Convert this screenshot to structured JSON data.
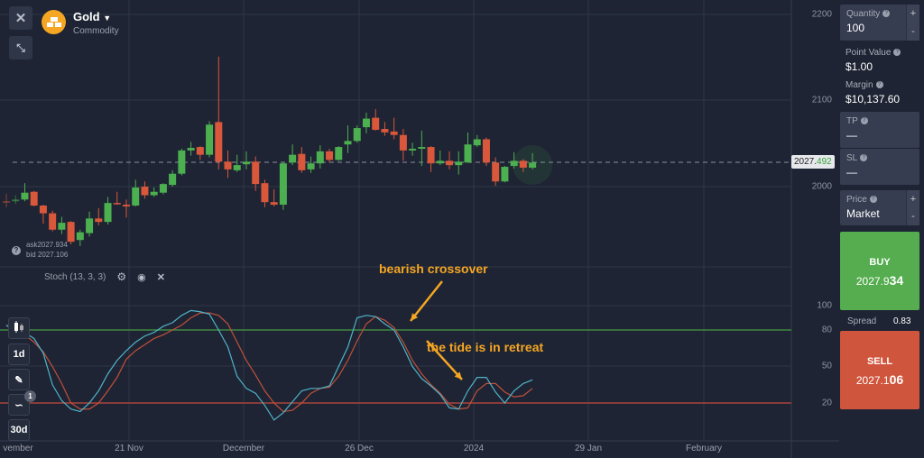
{
  "asset": {
    "name": "Gold",
    "type": "Commodity"
  },
  "toolbar": {
    "close_icon": "close-icon",
    "minimize_icon": "minimize-icon",
    "timeframe": "1d",
    "period": "30d",
    "indicator_count": "1"
  },
  "info": {
    "ask": "ask2027.934",
    "bid": "bid 2027.106"
  },
  "indicator": {
    "label": "Stoch (13, 3, 3)"
  },
  "annotations": {
    "a1": "bearish crossover",
    "a2": "the tide is in retreat",
    "color": "#f5a623"
  },
  "x_axis": [
    "vember",
    "21 Nov",
    "December",
    "26 Dec",
    "2024",
    "29 Jan",
    "February"
  ],
  "price_axis": [
    "2200",
    "2100",
    "2000"
  ],
  "stoch_axis": [
    "100",
    "80",
    "50",
    "20"
  ],
  "current_price": {
    "int": "2027.",
    "dec": "492"
  },
  "panel": {
    "quantity_label": "Quantity",
    "quantity": "100",
    "point_value_label": "Point Value",
    "point_value": "$1.00",
    "margin_label": "Margin",
    "margin": "$10,137.60",
    "tp_label": "TP",
    "tp": "—",
    "sl_label": "SL",
    "sl": "—",
    "price_label": "Price",
    "price": "Market",
    "buy_label": "BUY",
    "buy_int": "2027.9",
    "buy_dec": "34",
    "spread_label": "Spread",
    "spread": "0.83",
    "sell_label": "SELL",
    "sell_int": "2027.1",
    "sell_dec": "06",
    "plus": "+",
    "minus": "-"
  },
  "colors": {
    "up": "#4caf50",
    "down": "#d9573b",
    "k_line": "#4fb3c8",
    "d_line": "#c0503c",
    "buy": "#55ad4f",
    "sell": "#d0553d"
  },
  "chart_data": {
    "type": "candlestick",
    "ohlc": [
      [
        1983,
        1992,
        1976,
        1982
      ],
      [
        1983,
        1990,
        1980,
        1985
      ],
      [
        1985,
        2004,
        1983,
        1993
      ],
      [
        1994,
        1995,
        1977,
        1978
      ],
      [
        1978,
        1979,
        1957,
        1969
      ],
      [
        1969,
        1972,
        1948,
        1950
      ],
      [
        1950,
        1965,
        1945,
        1958
      ],
      [
        1959,
        1960,
        1933,
        1936
      ],
      [
        1938,
        1950,
        1931,
        1947
      ],
      [
        1946,
        1971,
        1942,
        1963
      ],
      [
        1963,
        1975,
        1955,
        1959
      ],
      [
        1959,
        1988,
        1956,
        1981
      ],
      [
        1981,
        1994,
        1979,
        1980
      ],
      [
        1979,
        1985,
        1964,
        1977
      ],
      [
        1978,
        2008,
        1977,
        1999
      ],
      [
        2000,
        2006,
        1986,
        1990
      ],
      [
        1990,
        1999,
        1988,
        1994
      ],
      [
        1993,
        2004,
        1991,
        2003
      ],
      [
        2002,
        2019,
        2000,
        2015
      ],
      [
        2015,
        2044,
        2013,
        2042
      ],
      [
        2042,
        2052,
        2036,
        2045
      ],
      [
        2046,
        2047,
        2031,
        2037
      ],
      [
        2037,
        2076,
        2034,
        2072
      ],
      [
        2075,
        2151,
        2020,
        2029
      ],
      [
        2029,
        2042,
        2010,
        2020
      ],
      [
        2019,
        2037,
        2017,
        2025
      ],
      [
        2026,
        2041,
        2020,
        2029
      ],
      [
        2029,
        2035,
        1995,
        2003
      ],
      [
        2004,
        2008,
        1976,
        1982
      ],
      [
        1982,
        1997,
        1977,
        1979
      ],
      [
        1979,
        2028,
        1973,
        2027
      ],
      [
        2028,
        2049,
        2025,
        2037
      ],
      [
        2038,
        2046,
        2016,
        2019
      ],
      [
        2020,
        2035,
        2016,
        2027
      ],
      [
        2027,
        2048,
        2021,
        2041
      ],
      [
        2041,
        2044,
        2028,
        2031
      ],
      [
        2031,
        2047,
        2030,
        2046
      ],
      [
        2049,
        2071,
        2039,
        2053
      ],
      [
        2053,
        2071,
        2051,
        2068
      ],
      [
        2069,
        2086,
        2062,
        2079
      ],
      [
        2080,
        2090,
        2065,
        2066
      ],
      [
        2067,
        2075,
        2059,
        2063
      ],
      [
        2064,
        2080,
        2055,
        2060
      ],
      [
        2060,
        2067,
        2030,
        2042
      ],
      [
        2042,
        2051,
        2036,
        2044
      ],
      [
        2044,
        2065,
        2024,
        2046
      ],
      [
        2046,
        2047,
        2017,
        2027
      ],
      [
        2027,
        2042,
        2025,
        2030
      ],
      [
        2030,
        2041,
        2020,
        2025
      ],
      [
        2025,
        2041,
        2014,
        2029
      ],
      [
        2028,
        2063,
        2028,
        2049
      ],
      [
        2048,
        2060,
        2046,
        2055
      ],
      [
        2055,
        2057,
        2024,
        2028
      ],
      [
        2028,
        2034,
        2001,
        2006
      ],
      [
        2006,
        2024,
        2005,
        2023
      ],
      [
        2024,
        2040,
        2021,
        2030
      ],
      [
        2030,
        2032,
        2017,
        2022
      ],
      [
        2022,
        2039,
        2020,
        2028
      ]
    ],
    "price_ylim": [
      1900,
      2200
    ],
    "stoch_k": [
      84,
      78,
      78,
      73,
      61,
      35,
      22,
      15,
      13,
      20,
      30,
      44,
      55,
      63,
      70,
      75,
      78,
      83,
      86,
      92,
      96,
      95,
      93,
      80,
      66,
      42,
      32,
      28,
      18,
      6,
      12,
      21,
      30,
      32,
      32,
      34,
      50,
      66,
      90,
      92,
      91,
      85,
      80,
      66,
      50,
      40,
      34,
      27,
      16,
      15,
      30,
      41,
      41,
      29,
      20,
      30,
      36,
      39
    ],
    "stoch_d": [
      84,
      80,
      76,
      70,
      62,
      50,
      36,
      20,
      15,
      15,
      20,
      30,
      41,
      56,
      63,
      68,
      73,
      76,
      80,
      84,
      90,
      94,
      94,
      92,
      85,
      70,
      55,
      43,
      30,
      20,
      13,
      14,
      20,
      28,
      32,
      33,
      42,
      55,
      71,
      85,
      91,
      88,
      82,
      70,
      55,
      44,
      35,
      28,
      19,
      15,
      16,
      30,
      36,
      36,
      29,
      25,
      26,
      32
    ],
    "stoch_levels": [
      80,
      20
    ],
    "stoch_ylim": [
      0,
      100
    ]
  }
}
